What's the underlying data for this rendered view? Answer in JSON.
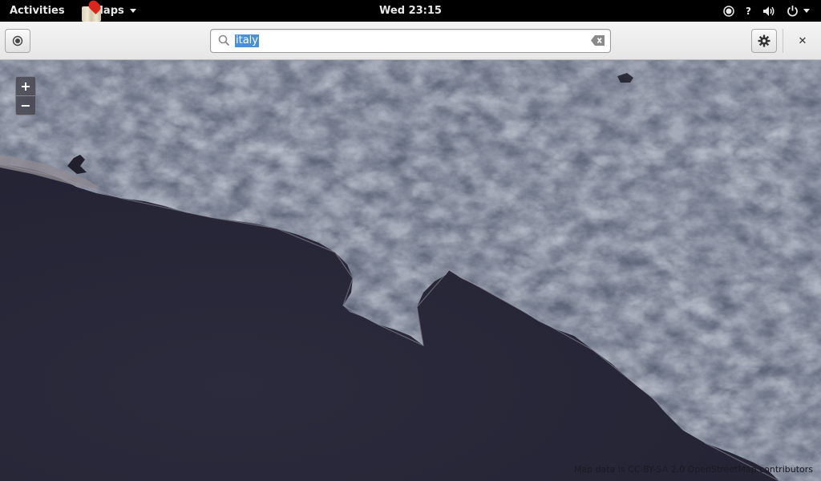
{
  "topbar": {
    "activities_label": "Activities",
    "app_name": "Maps",
    "clock": "Wed 23:15",
    "status_icons": [
      "accessibility-icon",
      "help-icon",
      "volume-icon",
      "power-icon"
    ],
    "help_glyph": "?"
  },
  "headerbar": {
    "search": {
      "value": "italy",
      "placeholder": ""
    },
    "close_glyph": "✕"
  },
  "map": {
    "zoom_in_label": "+",
    "zoom_out_label": "−",
    "attribution": "Map data is CC-BY-SA 2.0 OpenStreetMap contributors",
    "colors": {
      "sea": "#28283a",
      "land": "#6c7488",
      "land_dark": "#4a5266",
      "land_light": "#8c93a4"
    }
  }
}
